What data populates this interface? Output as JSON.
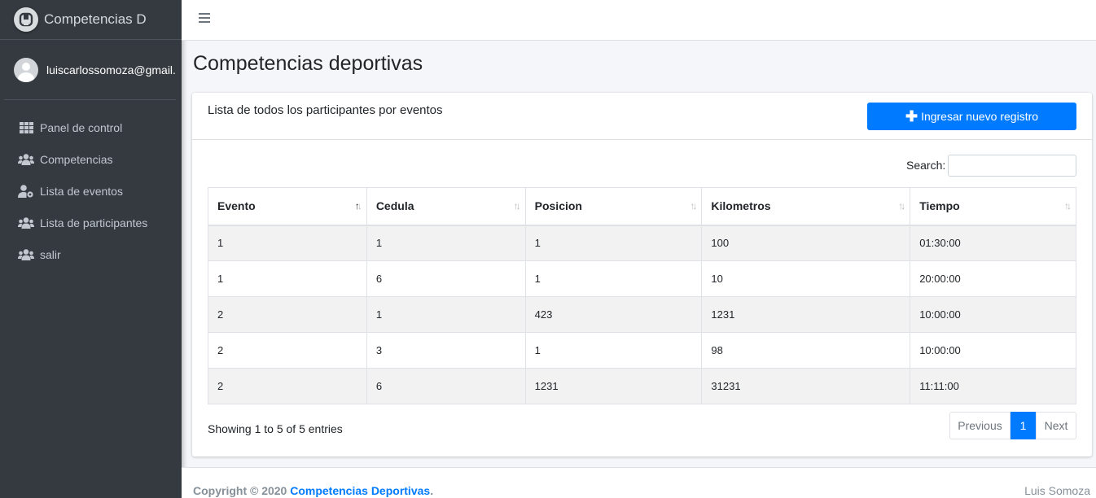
{
  "brand": {
    "title": "Competencias D",
    "logo_icon": "brand-logo-icon"
  },
  "user": {
    "email": "luiscarlossomoza@gmail.c"
  },
  "sidebar": {
    "items": [
      {
        "label": "Panel de control",
        "icon": "th-icon"
      },
      {
        "label": "Competencias",
        "icon": "users-icon"
      },
      {
        "label": "Lista de eventos",
        "icon": "user-cog-icon"
      },
      {
        "label": "Lista de participantes",
        "icon": "users-icon"
      },
      {
        "label": "salir",
        "icon": "users-icon"
      }
    ]
  },
  "page": {
    "title": "Competencias deportivas"
  },
  "card": {
    "title": "Lista de todos los participantes por eventos",
    "new_button": "Ingresar nuevo registro"
  },
  "search": {
    "label": "Search:",
    "value": ""
  },
  "table": {
    "columns": [
      "Evento",
      "Cedula",
      "Posicion",
      "Kilometros",
      "Tiempo"
    ],
    "sorted_column": "Evento",
    "rows": [
      [
        "1",
        "1",
        "1",
        "100",
        "01:30:00"
      ],
      [
        "1",
        "6",
        "1",
        "10",
        "20:00:00"
      ],
      [
        "2",
        "1",
        "423",
        "1231",
        "10:00:00"
      ],
      [
        "2",
        "3",
        "1",
        "98",
        "10:00:00"
      ],
      [
        "2",
        "6",
        "1231",
        "31231",
        "11:11:00"
      ]
    ]
  },
  "pagination": {
    "info": "Showing 1 to 5 of 5 entries",
    "previous": "Previous",
    "current": "1",
    "next": "Next"
  },
  "footer": {
    "copyright_prefix": "Copyright © 2020",
    "copyright_link": "Competencias Deportivas",
    "copyright_suffix": ".",
    "author": "Luis Somoza"
  },
  "colors": {
    "sidebar": "#343a40",
    "accent": "#007bff",
    "background": "#f4f6f9"
  }
}
